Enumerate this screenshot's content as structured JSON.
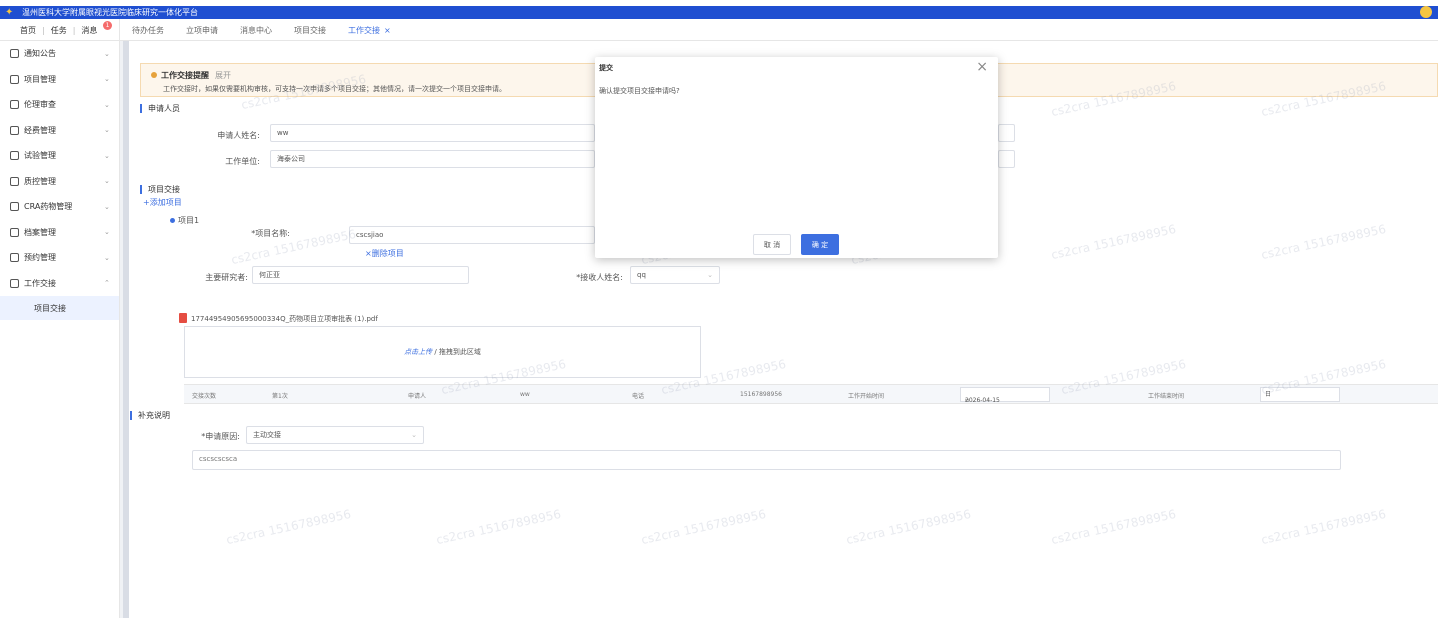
{
  "app": {
    "title": "温州医科大学附属眼视光医院临床研究一体化平台"
  },
  "nav": {
    "home": "首页",
    "tasks": "任务",
    "messages": "消息",
    "message_badge": "1"
  },
  "tabs": [
    {
      "label": "待办任务"
    },
    {
      "label": "立项申请"
    },
    {
      "label": "消息中心"
    },
    {
      "label": "项目交接"
    },
    {
      "label": "工作交接",
      "close": "×"
    }
  ],
  "sidebar": {
    "items": [
      {
        "label": "通知公告",
        "icon": "notice-icon"
      },
      {
        "label": "项目管理",
        "icon": "folder-icon"
      },
      {
        "label": "伦理审查",
        "icon": "ethics-icon"
      },
      {
        "label": "经费管理",
        "icon": "fund-icon"
      },
      {
        "label": "试验管理",
        "icon": "folder-icon"
      },
      {
        "label": "质控管理",
        "icon": "folder-icon"
      },
      {
        "label": "CRA药物管理",
        "icon": "drug-icon"
      },
      {
        "label": "档案管理",
        "icon": "archive-icon"
      },
      {
        "label": "预约管理",
        "icon": "folder-icon"
      },
      {
        "label": "工作交接",
        "icon": "handover-icon",
        "expanded": true
      }
    ],
    "subitem": "项目交接"
  },
  "notice": {
    "title": "工作交接提醒",
    "expand": "展开",
    "text": "工作交接时，如果仅需要机构审核，可支持一次申请多个项目交接；其他情况，请一次提交一个项目交接申请。"
  },
  "applicant": {
    "section_title": "申请人员",
    "name_label": "申请人姓名:",
    "name_value": "ww",
    "unit_label": "工作单位:",
    "unit_value": "海泰公司"
  },
  "project": {
    "section_title": "项目交接",
    "add_link": "+添加项目",
    "item_label": "项目1",
    "name_label": "*项目名称:",
    "name_value": "cscsjiao",
    "delete_link": "×删除项目",
    "pi_label": "主要研究者:",
    "pi_value": "何正亚",
    "receiver_label": "*接收人姓名:",
    "receiver_value": "qq"
  },
  "file": {
    "name": "17744954905695000334Q_药物项目立项审批表 (1).pdf",
    "upload_link": "点击上传",
    "upload_hint": " / 拖拽到此区域"
  },
  "handover_row": {
    "count_label": "交接次数",
    "count_value": "第1次",
    "applicant_label": "申请人",
    "applicant_value": "ww",
    "phone_label": "电话",
    "phone_value": "15167898956",
    "start_label": "工作开始时间",
    "start_value": "2026-04-15",
    "end_label": "工作结束时间",
    "end_value": "日"
  },
  "supplement": {
    "section_title": "补充说明",
    "reason_label": "*申请原因:",
    "reason_value": "主动交接",
    "note_value": "cscscscsca"
  },
  "dialog": {
    "title": "提交",
    "message": "确认提交项目交接申请吗?",
    "cancel": "取 消",
    "ok": "确 定",
    "close": "×"
  },
  "watermark": "cs2cra 15167898956"
}
